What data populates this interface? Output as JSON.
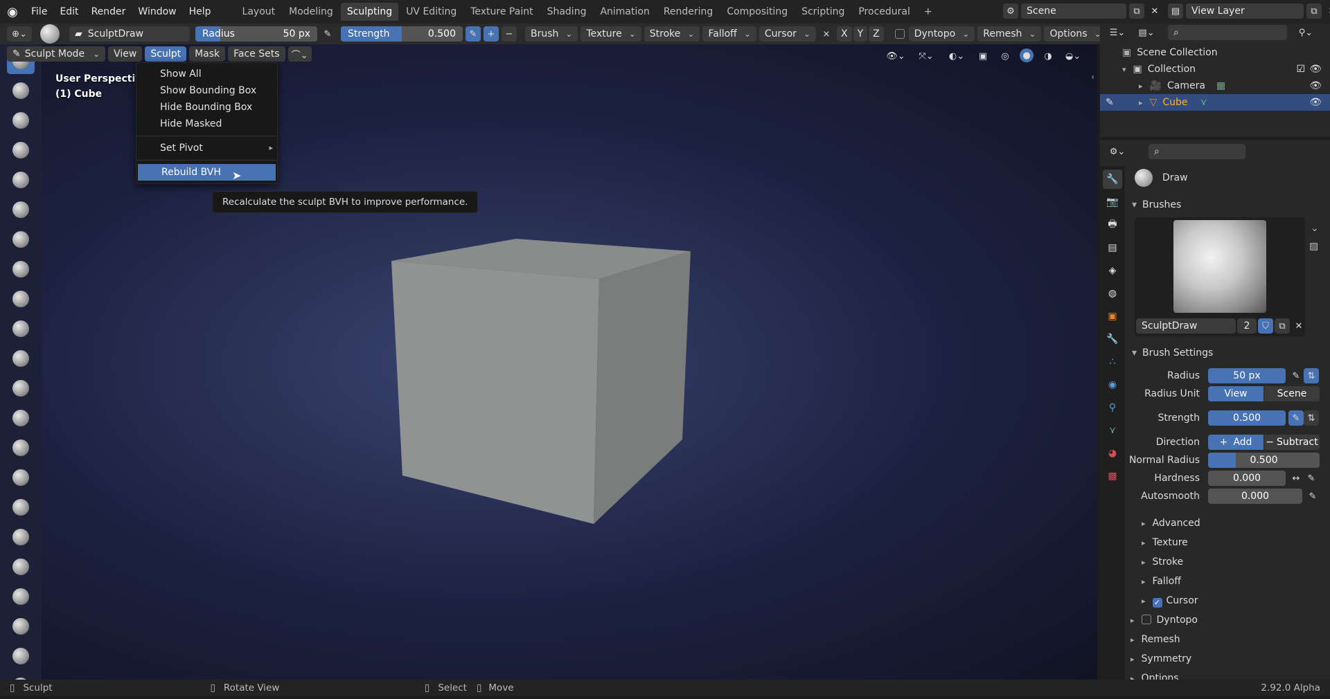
{
  "topbar": {
    "menus": [
      "File",
      "Edit",
      "Render",
      "Window",
      "Help"
    ],
    "workspaces": [
      "Layout",
      "Modeling",
      "Sculpting",
      "UV Editing",
      "Texture Paint",
      "Shading",
      "Animation",
      "Rendering",
      "Compositing",
      "Scripting",
      "Procedural"
    ],
    "active_workspace": "Sculpting",
    "scene": "Scene",
    "view_layer": "View Layer"
  },
  "toolbar": {
    "brush_name": "SculptDraw",
    "radius_label": "Radius",
    "radius_value": "50 px",
    "strength_label": "Strength",
    "strength_value": "0.500",
    "dropdowns": [
      "Brush",
      "Texture",
      "Stroke",
      "Falloff",
      "Cursor"
    ],
    "axes": [
      "X",
      "Y",
      "Z"
    ],
    "dyntopo": "Dyntopo",
    "remesh": "Remesh",
    "options": "Options"
  },
  "header": {
    "mode": "Sculpt Mode",
    "menus": [
      "View",
      "Sculpt",
      "Mask",
      "Face Sets"
    ],
    "active_menu": "Sculpt"
  },
  "viewport": {
    "perspective": "User Perspective",
    "object": "(1) Cube"
  },
  "sculpt_menu": {
    "items": [
      "Show All",
      "Show Bounding Box",
      "Hide Bounding Box",
      "Hide Masked",
      "Set Pivot",
      "Rebuild BVH"
    ],
    "highlighted": "Rebuild BVH",
    "tooltip": "Recalculate the sculpt BVH to improve performance."
  },
  "outliner": {
    "root": "Scene Collection",
    "collection": "Collection",
    "items": [
      "Camera",
      "Cube"
    ],
    "selected": "Cube"
  },
  "properties": {
    "tool_name": "Draw",
    "brushes_header": "Brushes",
    "brush_name": "SculptDraw",
    "brush_users": "2",
    "brush_settings_header": "Brush Settings",
    "radius_label": "Radius",
    "radius_value": "50 px",
    "radius_unit_label": "Radius Unit",
    "radius_unit_view": "View",
    "radius_unit_scene": "Scene",
    "strength_label": "Strength",
    "strength_value": "0.500",
    "direction_label": "Direction",
    "direction_add": "Add",
    "direction_subtract": "Subtract",
    "normal_radius_label": "Normal Radius",
    "normal_radius_value": "0.500",
    "normal_radius_fraction": 0.25,
    "hardness_label": "Hardness",
    "hardness_value": "0.000",
    "autosmooth_label": "Autosmooth",
    "autosmooth_value": "0.000",
    "subpanels": [
      "Advanced",
      "Texture",
      "Stroke",
      "Falloff",
      "Cursor"
    ],
    "sections": [
      "Dyntopo",
      "Remesh",
      "Symmetry",
      "Options"
    ]
  },
  "statusbar": {
    "sculpt": "Sculpt",
    "rotate": "Rotate View",
    "select": "Select",
    "move": "Move",
    "version": "2.92.0 Alpha"
  },
  "colors": {
    "accent": "#4772b3",
    "orange": "#e08a2c"
  }
}
